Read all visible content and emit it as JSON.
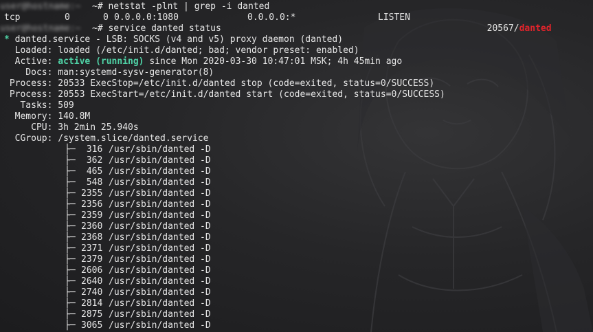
{
  "hidden_prompt": "user@hostname:~",
  "cmd1": {
    "suffix": "~# netstat -plnt | grep -i danted"
  },
  "netstat_row": {
    "proto": "tcp",
    "recv_q": "0",
    "send_q": "0",
    "local": "0.0.0.0:1080",
    "foreign": "0.0.0.0:*",
    "state": "LISTEN",
    "pid": "20567/",
    "program": "danted"
  },
  "cmd2": {
    "suffix": "~# service danted status"
  },
  "status": {
    "bullet": "*",
    "header": " danted.service - LSB: SOCKS (v4 and v5) proxy daemon (danted)",
    "loaded_label": "  Loaded:",
    "loaded_value": " loaded (/etc/init.d/danted; bad; vendor preset: enabled)",
    "active_label": "  Active:",
    "active_state": "active (running)",
    "active_rest": " since Mon 2020-03-30 10:47:01 MSK; 4h 45min ago",
    "docs_label": "    Docs:",
    "docs_value": " man:systemd-sysv-generator(8)",
    "process1_label": " Process:",
    "process1_value": " 20533 ExecStop=/etc/init.d/danted stop (code=exited, status=0/SUCCESS)",
    "process2_label": " Process:",
    "process2_value": " 20553 ExecStart=/etc/init.d/danted start (code=exited, status=0/SUCCESS)",
    "tasks_label": "   Tasks:",
    "tasks_value": " 509",
    "memory_label": "  Memory:",
    "memory_value": " 140.8M",
    "cpu_label": "     CPU:",
    "cpu_value": " 3h 2min 25.940s",
    "cgroup_label": "  CGroup:",
    "cgroup_value": " /system.slice/danted.service"
  },
  "tree_glyph": "├─",
  "cgroup_processes": [
    {
      "pid": " 316",
      "cmd": "/usr/sbin/danted -D"
    },
    {
      "pid": " 362",
      "cmd": "/usr/sbin/danted -D"
    },
    {
      "pid": " 465",
      "cmd": "/usr/sbin/danted -D"
    },
    {
      "pid": " 548",
      "cmd": "/usr/sbin/danted -D"
    },
    {
      "pid": "2355",
      "cmd": "/usr/sbin/danted -D"
    },
    {
      "pid": "2356",
      "cmd": "/usr/sbin/danted -D"
    },
    {
      "pid": "2359",
      "cmd": "/usr/sbin/danted -D"
    },
    {
      "pid": "2360",
      "cmd": "/usr/sbin/danted -D"
    },
    {
      "pid": "2368",
      "cmd": "/usr/sbin/danted -D"
    },
    {
      "pid": "2371",
      "cmd": "/usr/sbin/danted -D"
    },
    {
      "pid": "2379",
      "cmd": "/usr/sbin/danted -D"
    },
    {
      "pid": "2606",
      "cmd": "/usr/sbin/danted -D"
    },
    {
      "pid": "2640",
      "cmd": "/usr/sbin/danted -D"
    },
    {
      "pid": "2740",
      "cmd": "/usr/sbin/danted -D"
    },
    {
      "pid": "2814",
      "cmd": "/usr/sbin/danted -D"
    },
    {
      "pid": "2875",
      "cmd": "/usr/sbin/danted -D"
    },
    {
      "pid": "3065",
      "cmd": "/usr/sbin/danted -D"
    }
  ],
  "colors": {
    "background": "#1f1f21",
    "text": "#e6e6e6",
    "active": "#4fd1a5",
    "program": "#e0242b"
  }
}
